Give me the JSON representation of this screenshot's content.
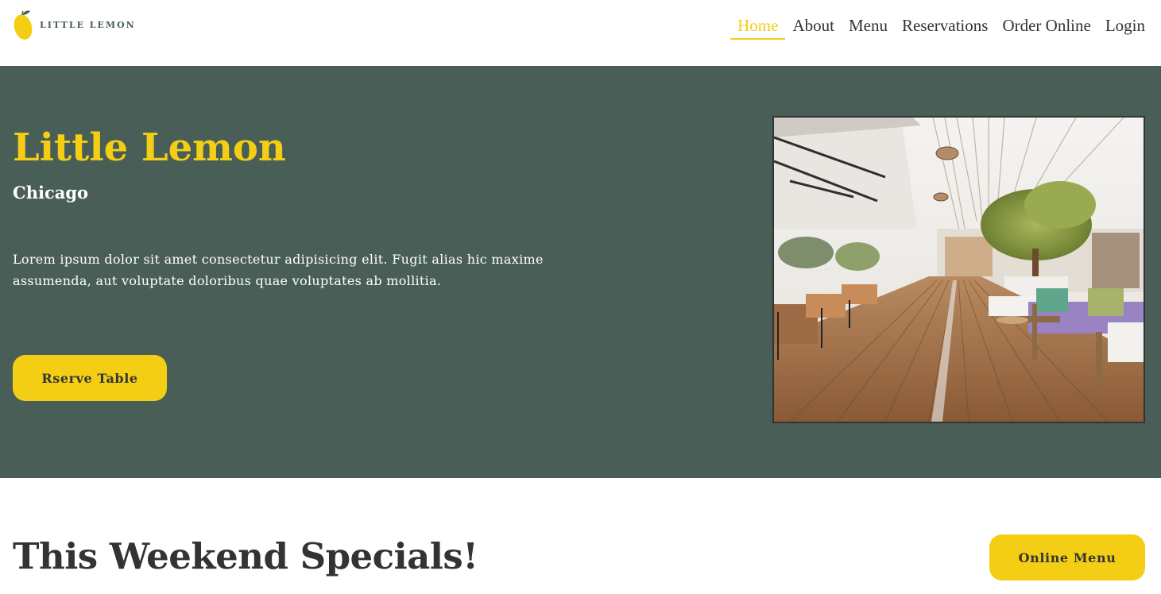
{
  "brand": {
    "logo_text": "LITTLE LEMON",
    "colors": {
      "primary_green": "#495e57",
      "primary_yellow": "#f4ce14",
      "text_dark": "#333333"
    }
  },
  "nav": {
    "items": [
      {
        "label": "Home",
        "active": true
      },
      {
        "label": "About",
        "active": false
      },
      {
        "label": "Menu",
        "active": false
      },
      {
        "label": "Reservations",
        "active": false
      },
      {
        "label": "Order Online",
        "active": false
      },
      {
        "label": "Login",
        "active": false
      }
    ]
  },
  "hero": {
    "title": "Little Lemon",
    "subtitle": "Chicago",
    "description": "Lorem ipsum dolor sit amet consectetur adipisicing elit. Fugit alias hic maxime assumenda, aut voluptate doloribus quae voluptates ab mollitia.",
    "button_label": "Rserve Table",
    "image_icon": "restaurant-interior-photo"
  },
  "specials": {
    "title": "This Weekend Specials!",
    "button_label": "Online Menu"
  }
}
